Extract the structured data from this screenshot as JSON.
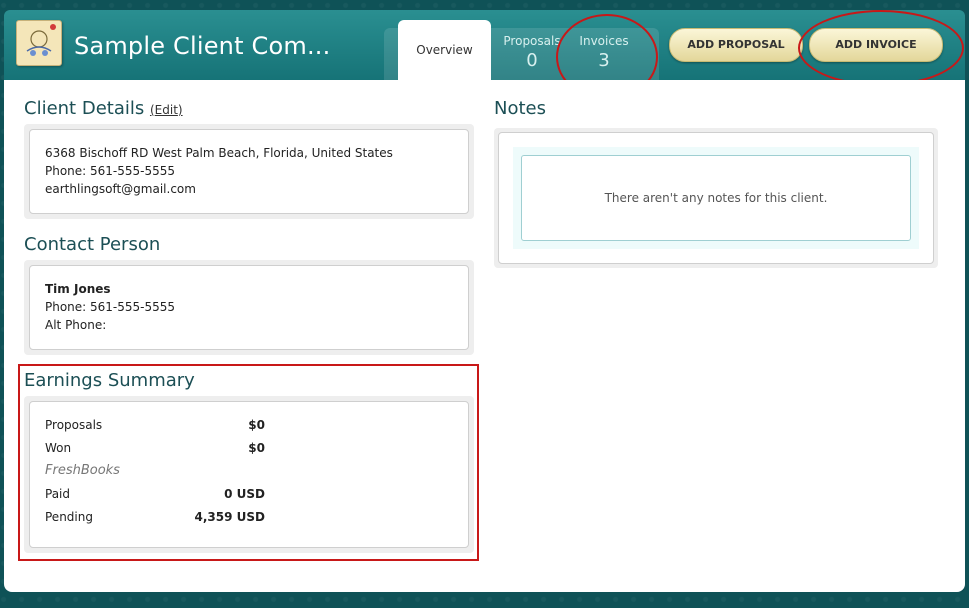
{
  "header": {
    "client_name": "Sample Client Com...",
    "tabs": [
      {
        "label": "Overview"
      },
      {
        "label": "Proposals",
        "count": "0"
      },
      {
        "label": "Invoices",
        "count": "3"
      }
    ],
    "add_proposal_label": "ADD PROPOSAL",
    "add_invoice_label": "ADD INVOICE"
  },
  "client_details": {
    "title": "Client Details",
    "edit_label": "Edit",
    "address": "6368 Bischoff RD West Palm Beach, Florida, United States",
    "phone": "Phone: 561-555-5555",
    "email": "earthlingsoft@gmail.com"
  },
  "contact_person": {
    "title": "Contact Person",
    "name": "Tim Jones",
    "phone": "Phone: 561-555-5555",
    "alt_phone": "Alt Phone:"
  },
  "earnings": {
    "title": "Earnings Summary",
    "rows": [
      {
        "label": "Proposals",
        "value": "$0"
      },
      {
        "label": "Won",
        "value": "$0"
      },
      {
        "label": "FreshBooks",
        "value": ""
      },
      {
        "label": "Paid",
        "value": "0 USD"
      },
      {
        "label": "Pending",
        "value": "4,359 USD"
      }
    ]
  },
  "notes": {
    "title": "Notes",
    "empty_message": "There aren't any notes for this client."
  },
  "colors": {
    "header": "#167377",
    "title_text": "#1c4f55",
    "annotation_red": "#c81818",
    "button": "#efe6b5"
  }
}
